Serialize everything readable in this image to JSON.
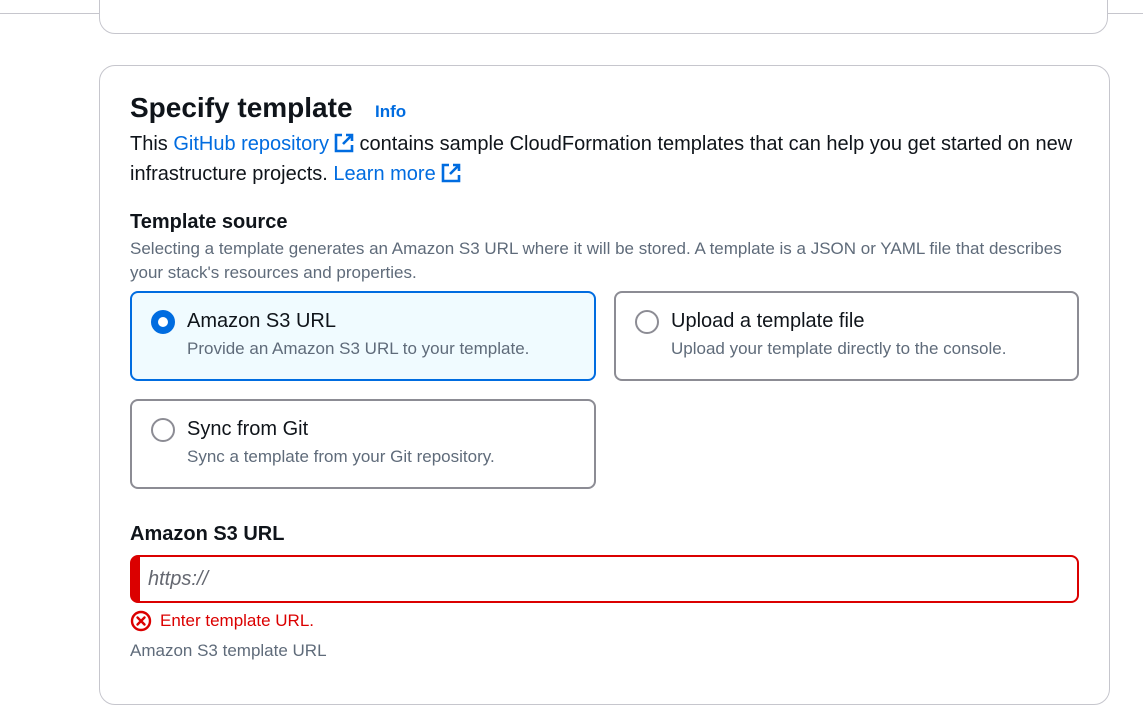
{
  "header": {
    "title": "Specify template",
    "info_link": "Info"
  },
  "description": {
    "prefix": "This ",
    "github_link": "GitHub repository",
    "middle": " contains sample CloudFormation templates that can help you get started on new infrastructure projects. ",
    "learn_more": "Learn more"
  },
  "template_source": {
    "label": "Template source",
    "description": "Selecting a template generates an Amazon S3 URL where it will be stored. A template is a JSON or YAML file that describes your stack's resources and properties.",
    "options": [
      {
        "label": "Amazon S3 URL",
        "description": "Provide an Amazon S3 URL to your template.",
        "selected": true
      },
      {
        "label": "Upload a template file",
        "description": "Upload your template directly to the console.",
        "selected": false
      },
      {
        "label": "Sync from Git",
        "description": "Sync a template from your Git repository.",
        "selected": false
      }
    ]
  },
  "s3_url": {
    "label": "Amazon S3 URL",
    "placeholder": "https://",
    "value": "",
    "error": "Enter template URL.",
    "help": "Amazon S3 template URL"
  },
  "colors": {
    "link": "#006ce0",
    "selected_border": "#006ce0",
    "selected_bg": "#f0fbff",
    "error": "#db0000",
    "secondary_text": "#5f6b7a"
  },
  "icons": {
    "external_link": "external-link-icon",
    "error": "error-circle-x-icon"
  }
}
